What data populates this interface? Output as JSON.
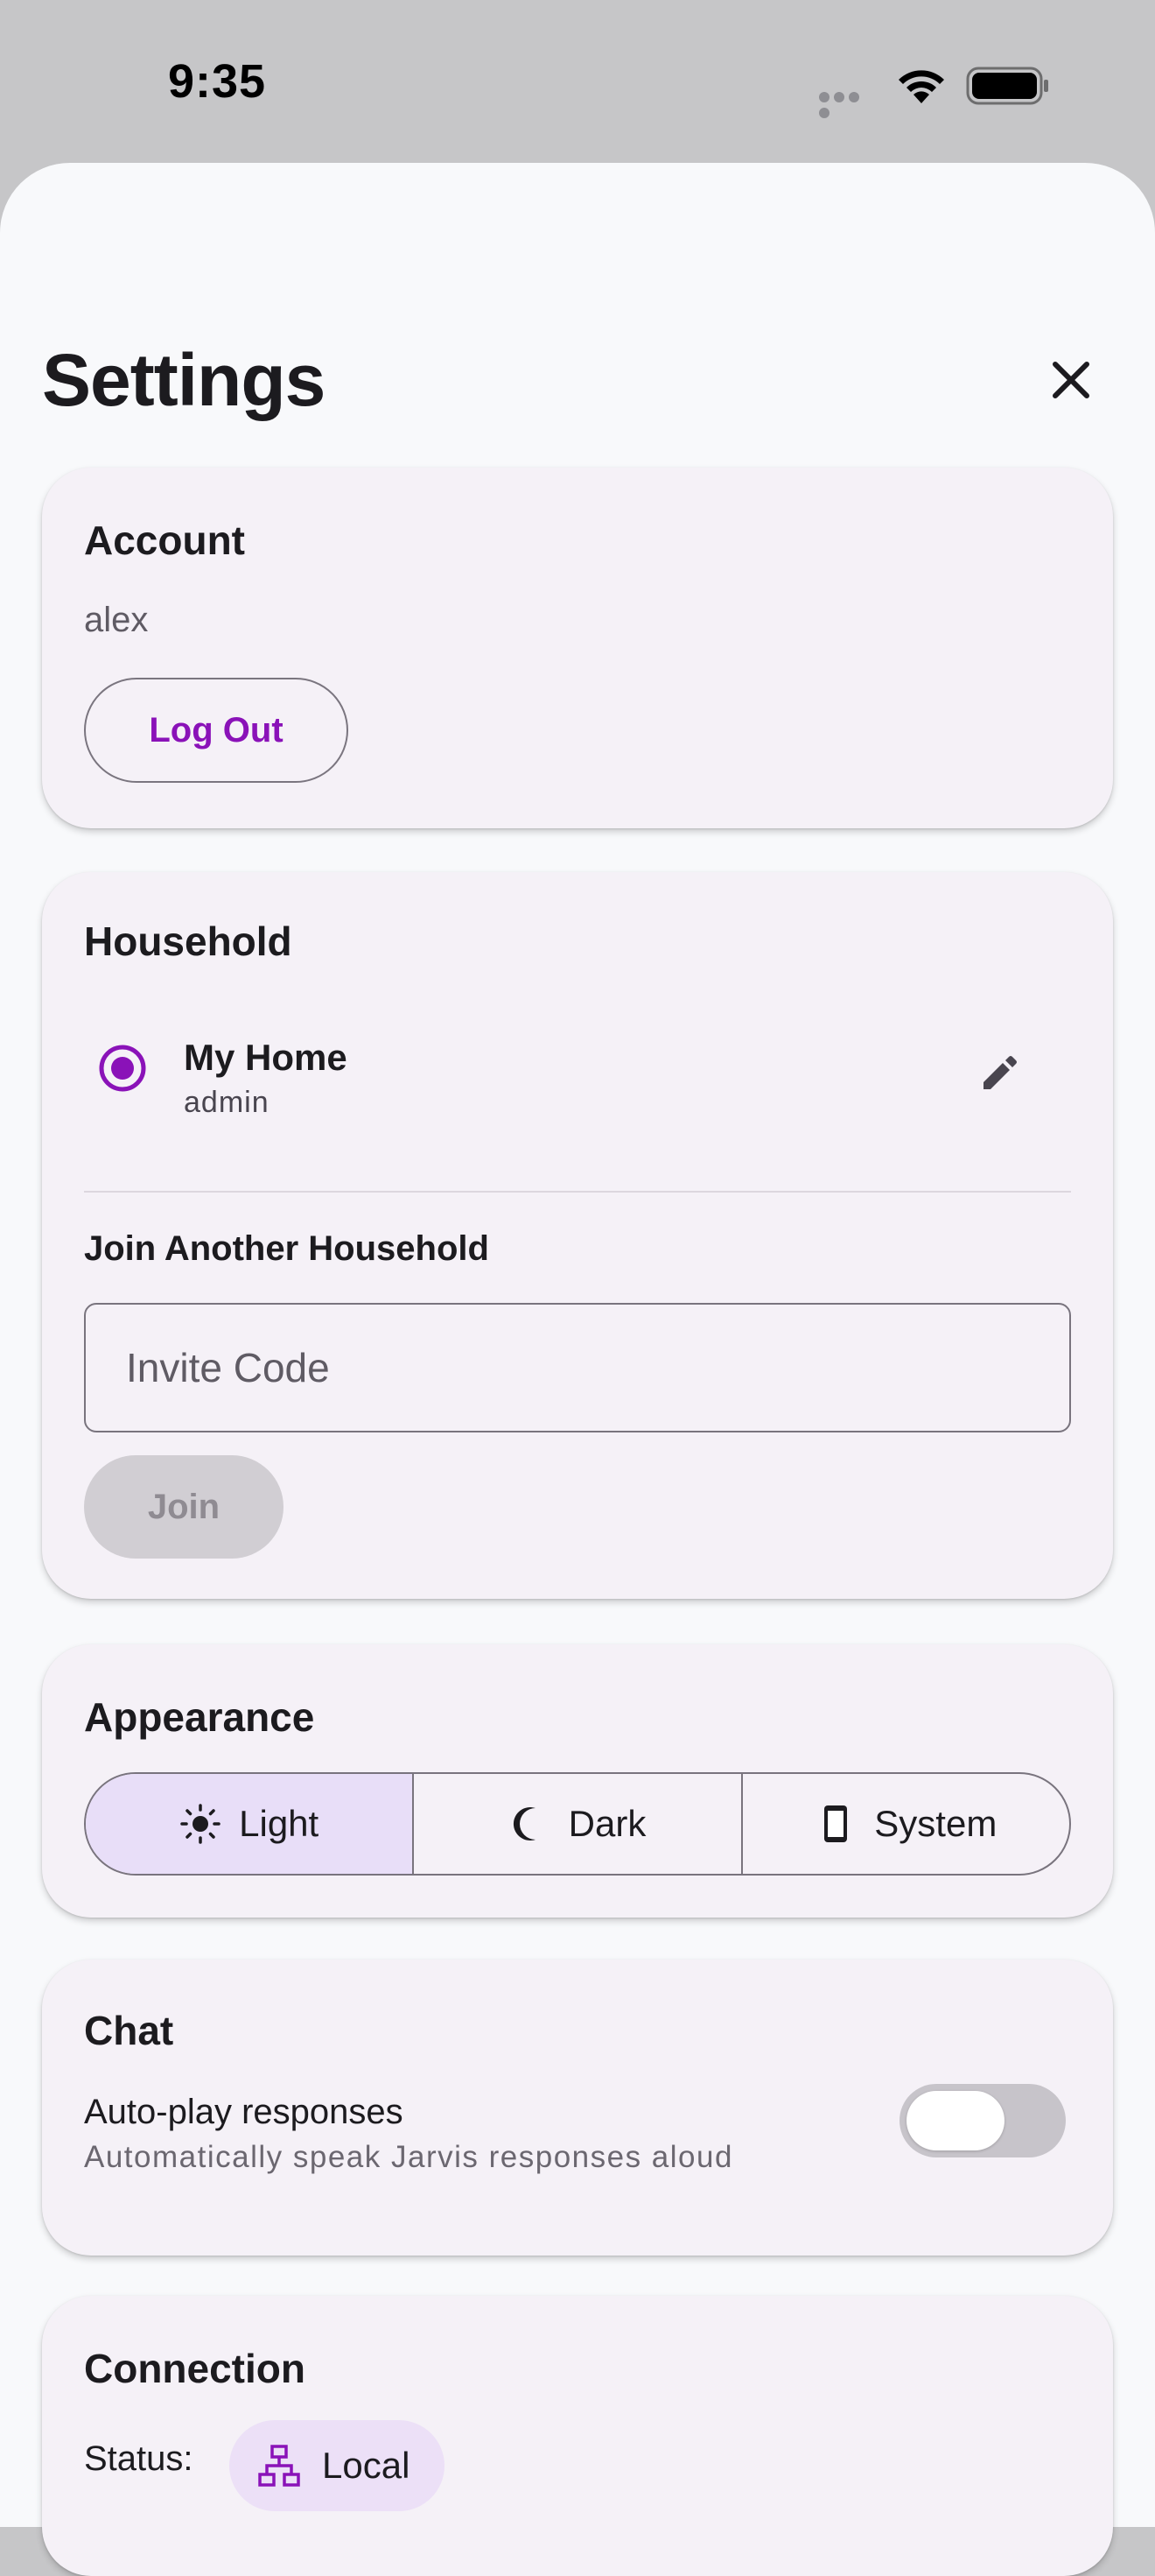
{
  "status_bar": {
    "time": "9:35",
    "icons": [
      "signal-dots-icon",
      "wifi-icon",
      "battery-icon"
    ]
  },
  "sheet": {
    "title": "Settings",
    "close_icon": "close-icon"
  },
  "account": {
    "title": "Account",
    "username": "alex",
    "logout_label": "Log Out"
  },
  "household": {
    "title": "Household",
    "items": [
      {
        "name": "My Home",
        "role": "admin",
        "selected": true,
        "edit_icon": "pencil-icon"
      }
    ],
    "join_title": "Join Another Household",
    "invite_placeholder": "Invite Code",
    "invite_value": "",
    "join_label": "Join",
    "join_enabled": false
  },
  "appearance": {
    "title": "Appearance",
    "options": [
      {
        "label": "Light",
        "icon": "sun-icon",
        "selected": true
      },
      {
        "label": "Dark",
        "icon": "moon-icon",
        "selected": false
      },
      {
        "label": "System",
        "icon": "phone-icon",
        "selected": false
      }
    ]
  },
  "chat": {
    "title": "Chat",
    "autoplay_title": "Auto-play responses",
    "autoplay_subtitle": "Automatically speak Jarvis responses aloud",
    "autoplay_enabled": false
  },
  "connection": {
    "title": "Connection",
    "status_label": "Status:",
    "status_value": "Local",
    "status_icon": "network-icon"
  },
  "colors": {
    "accent": "#8a12b8",
    "selected_segment": "#e8def8",
    "card_bg": "#f5f1f7",
    "sheet_bg": "#f8f9fb"
  }
}
